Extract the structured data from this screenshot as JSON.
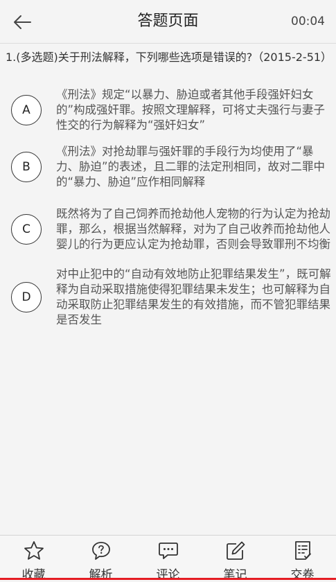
{
  "header": {
    "title": "答题页面",
    "timer": "00:04",
    "back_icon": "arrow-left-icon"
  },
  "question": {
    "text": "1.(多选题)关于刑法解释，下列哪些选项是错误的?（2015-2-51）"
  },
  "options": [
    {
      "letter": "A",
      "text": "《刑法》规定“以暴力、胁迫或者其他手段强奸妇女的”构成强奸罪。按照文理解释，可将丈夫强行与妻子性交的行为解释为“强奸妇女”"
    },
    {
      "letter": "B",
      "text": "《刑法》对抢劫罪与强奸罪的手段行为均使用了“暴力、胁迫”的表述，且二罪的法定刑相同，故对二罪中的“暴力、胁迫”应作相同解释"
    },
    {
      "letter": "C",
      "text": "既然将为了自己饲养而抢劫他人宠物的行为认定为抢劫罪，那么，根据当然解释，对为了自己收养而抢劫他人婴儿的行为更应认定为抢劫罪，否则会导致罪刑不均衡"
    },
    {
      "letter": "D",
      "text": "对中止犯中的“自动有效地防止犯罪结果发生”，既可解释为自动采取措施使得犯罪结果未发生；也可解释为自动采取防止犯罪结果发生的有效措施，而不管犯罪结果是否发生"
    }
  ],
  "tabbar": {
    "items": [
      {
        "label": "收藏",
        "icon": "star-icon"
      },
      {
        "label": "解析",
        "icon": "question-bubble-icon"
      },
      {
        "label": "评论",
        "icon": "comment-icon"
      },
      {
        "label": "笔记",
        "icon": "edit-note-icon"
      },
      {
        "label": "交卷",
        "icon": "submit-paper-icon"
      }
    ]
  },
  "colors": {
    "accent_line": "#e51c23",
    "background": "#f4f4f4"
  }
}
